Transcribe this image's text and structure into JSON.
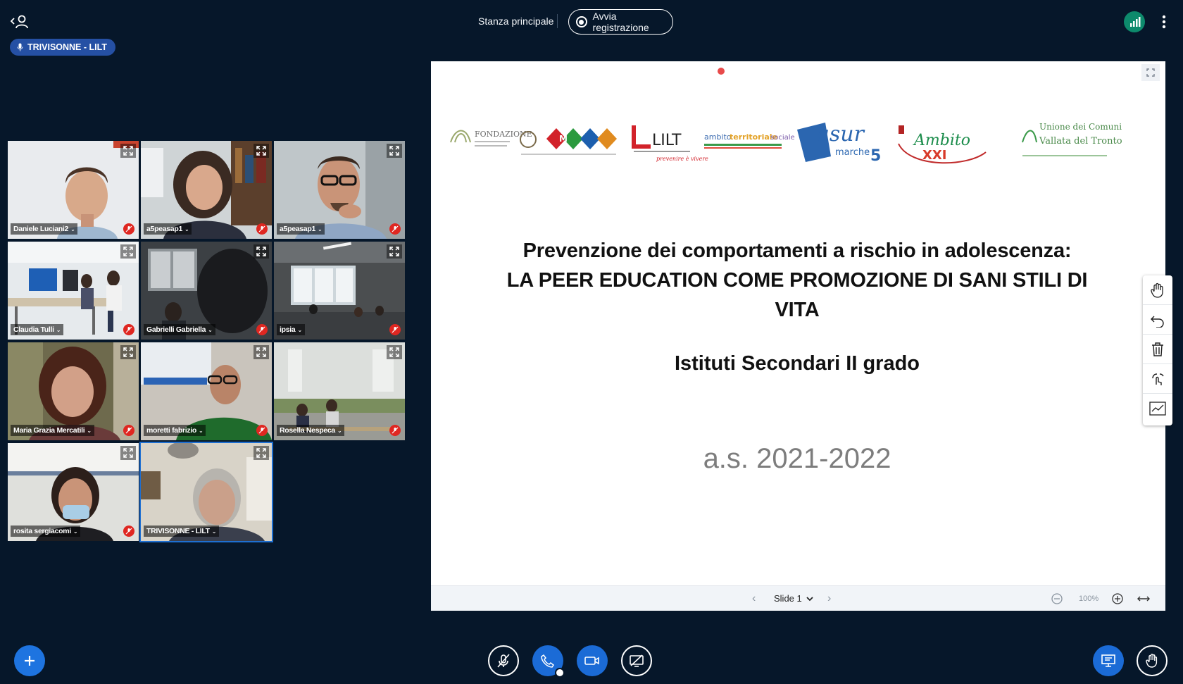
{
  "header": {
    "room_title": "Stanza principale",
    "record_label": "Avvia registrazione"
  },
  "talking_indicator": {
    "name": "TRIVISONNE - LILT"
  },
  "webcams": [
    {
      "name": "Daniele Luciani2",
      "muted": true
    },
    {
      "name": "a5peasap1",
      "muted": true
    },
    {
      "name": "a5peasap1",
      "muted": true
    },
    {
      "name": "Claudia Tulli",
      "muted": true
    },
    {
      "name": "Gabrielli Gabriella",
      "muted": true
    },
    {
      "name": "ipsia",
      "muted": true
    },
    {
      "name": "Maria Grazia Mercatili",
      "muted": true
    },
    {
      "name": "moretti fabrizio",
      "muted": true
    },
    {
      "name": "Rosella Nespeca",
      "muted": true
    },
    {
      "name": "rosita sergiacomi",
      "muted": true
    },
    {
      "name": "TRIVISONNE - LILT",
      "muted": false
    }
  ],
  "slide": {
    "title_line1": "Prevenzione dei comportamenti a rischio in adolescenza:",
    "title_line2": "LA PEER EDUCATION COME PROMOZIONE DI SANI STILI DI",
    "title_line3": "VITA",
    "subtitle": "Istituti Secondari II grado",
    "year": "a.s. 2021-2022",
    "logos": [
      "FONDAZIONE",
      "MIUR",
      "LILT",
      "ambitoterritoriale sociale",
      "asur marche 5",
      "Ambito territoriale sociale XXI",
      "Unione dei Comuni Vallata del Tronto"
    ]
  },
  "presentation_toolbar": {
    "slide_label": "Slide 1",
    "zoom_level": "100%"
  },
  "colors": {
    "background": "#06172a",
    "accent": "#1b6bd6",
    "muted_badge": "#df2721",
    "connection": "#0d8a6c"
  }
}
